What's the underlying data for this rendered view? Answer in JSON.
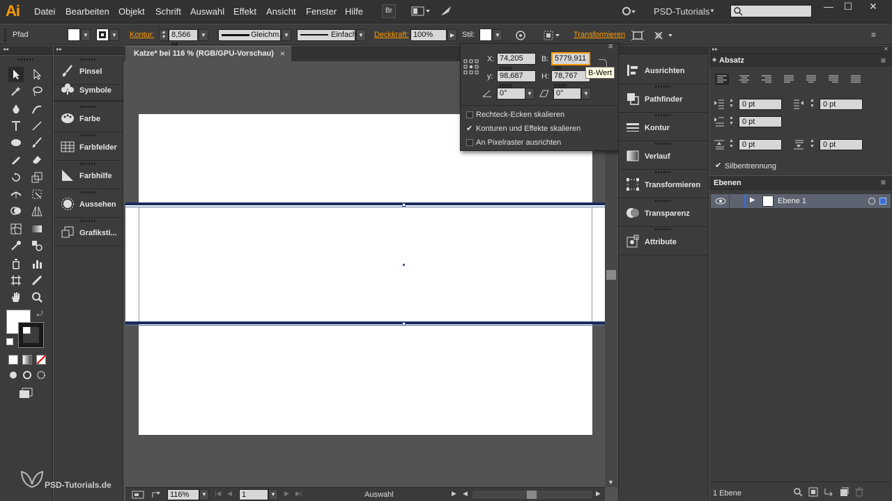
{
  "app": {
    "logo": "Ai",
    "workspace": "PSD-Tutorials",
    "brand": "PSD-Tutorials.de"
  },
  "menu": [
    "Datei",
    "Bearbeiten",
    "Objekt",
    "Schrift",
    "Auswahl",
    "Effekt",
    "Ansicht",
    "Fenster",
    "Hilfe"
  ],
  "top_buttons": {
    "bridge": "Br"
  },
  "control": {
    "selection_type": "Pfad",
    "kontur_label": "Kontur:",
    "kontur_value": "8,566 pt",
    "stroke_profile": "Gleichm.",
    "brush": "Einfach",
    "opacity_label": "Deckkraft:",
    "opacity_value": "100%",
    "style_label": "Stil:",
    "transform_link": "Transformieren"
  },
  "document": {
    "tab_title": "Katze* bei 116 % (RGB/GPU-Vorschau)",
    "close": "×"
  },
  "transform": {
    "x_label": "X:",
    "x_value": "74,205 mm",
    "y_label": "y:",
    "y_value": "98,687 mm",
    "w_label": "B:",
    "w_value": "5779,911 m",
    "h_label": "H:",
    "h_value": "78,767 mm",
    "angle_value": "0°",
    "shear_value": "0°",
    "tooltip": "B-Wert",
    "options": [
      {
        "label": "Rechteck-Ecken skalieren",
        "checked": false
      },
      {
        "label": "Konturen und Effekte skalieren",
        "checked": true
      },
      {
        "label": "An Pixelraster ausrichten",
        "checked": false
      }
    ]
  },
  "left_panels": [
    "Pinsel",
    "Symbole",
    "Farbe",
    "Farbfelder",
    "Farbhilfe",
    "Aussehen",
    "Grafiksti..."
  ],
  "right_panels": [
    "Ausrichten",
    "Pathfinder",
    "Kontur",
    "Verlauf",
    "Transformieren",
    "Transparenz",
    "Attribute"
  ],
  "absatz": {
    "title": "Absatz",
    "indent_left": "0 pt",
    "indent_right": "0 pt",
    "first_line": "0 pt",
    "space_before": "0 pt",
    "space_after": "0 pt",
    "hyphenation": "Silbentrennung"
  },
  "ebenen": {
    "title": "Ebenen",
    "layer_name": "Ebene 1",
    "count": "1 Ebene"
  },
  "status": {
    "zoom": "116%",
    "artboard": "1",
    "tool": "Auswahl"
  },
  "colors": {
    "accent": "#ff9a00",
    "panel": "#3c3c3c",
    "canvas": "#535353",
    "selection": "#1a2b5c"
  }
}
